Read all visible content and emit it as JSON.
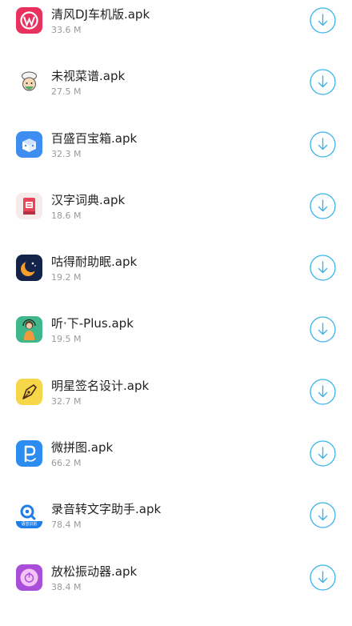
{
  "apps": [
    {
      "name": "",
      "size": "",
      "icon": "red-app-icon",
      "color": "#e8333a"
    },
    {
      "name": "清风DJ车机版.apk",
      "size": "33.6 M",
      "icon": "qingfeng-dj-icon",
      "color": "#e9315f"
    },
    {
      "name": "未视菜谱.apk",
      "size": "27.5 M",
      "icon": "chef-icon",
      "color": "#ffffff"
    },
    {
      "name": "百盛百宝箱.apk",
      "size": "32.3 M",
      "icon": "toolbox-icon",
      "color": "#3d8ef0"
    },
    {
      "name": "汉字词典.apk",
      "size": "18.6 M",
      "icon": "dictionary-icon",
      "color": "#f7eaea"
    },
    {
      "name": "咕得耐助眠.apk",
      "size": "19.2 M",
      "icon": "moon-icon",
      "color": "#13234a"
    },
    {
      "name": "听·下-Plus.apk",
      "size": "19.5 M",
      "icon": "music-girl-icon",
      "color": "#3fb78a"
    },
    {
      "name": "明星签名设计.apk",
      "size": "32.7 M",
      "icon": "pen-nib-icon",
      "color": "#f6d74a"
    },
    {
      "name": "微拼图.apk",
      "size": "66.2 M",
      "icon": "puzzle-p-icon",
      "color": "#2d8cf0"
    },
    {
      "name": "录音转文字助手.apk",
      "size": "78.4 M",
      "icon": "voice-recognition-icon",
      "color": "#1f7de8",
      "icon_caption": "语音识别"
    },
    {
      "name": "放松振动器.apk",
      "size": "38.4 M",
      "icon": "vibrator-power-icon",
      "color": "#a84ed8"
    }
  ],
  "download_icon": "download-arrow-icon",
  "accent": "#3bb3e8"
}
